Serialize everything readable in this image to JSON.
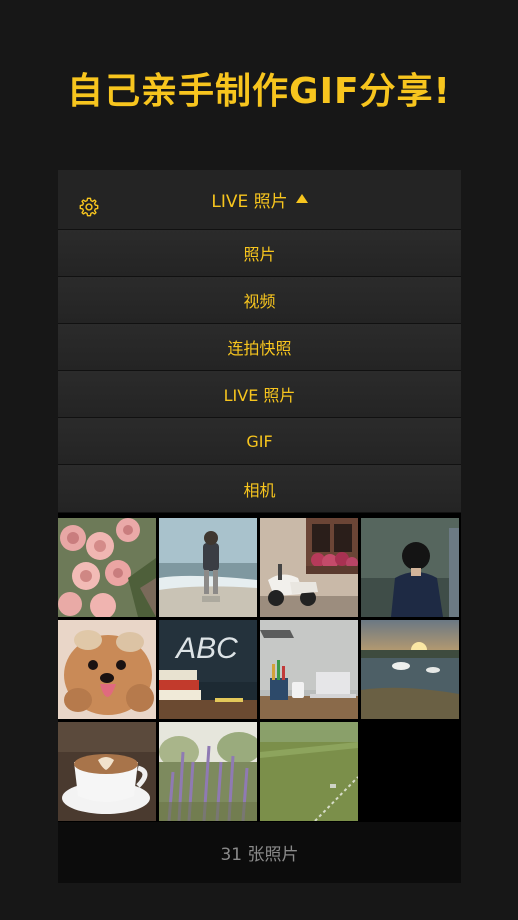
{
  "headline": "自己亲手制作GIF分享!",
  "colors": {
    "accent": "#F7C51E",
    "background": "#171717",
    "bar": "#242424"
  },
  "topbar": {
    "settings_icon": "gear-icon",
    "album_title": "LIVE 照片",
    "caret_icon": "caret-up-icon"
  },
  "menu": {
    "items": [
      {
        "label": "照片"
      },
      {
        "label": "视频"
      },
      {
        "label": "连拍快照"
      },
      {
        "label": "LIVE 照片"
      },
      {
        "label": "GIF"
      },
      {
        "label": "相机"
      }
    ]
  },
  "photos": [
    {
      "subject": "pink roses"
    },
    {
      "subject": "child on beach"
    },
    {
      "subject": "scooter and flowers"
    },
    {
      "subject": "boy in jacket"
    },
    {
      "subject": "yorkshire terrier"
    },
    {
      "subject": "ABC chalkboard and books"
    },
    {
      "subject": "desk with laptop"
    },
    {
      "subject": "swans at sunset"
    },
    {
      "subject": "latte art coffee"
    },
    {
      "subject": "lavender field"
    },
    {
      "subject": "grass sprinkler"
    }
  ],
  "footer": {
    "count_text": "31 张照片"
  }
}
